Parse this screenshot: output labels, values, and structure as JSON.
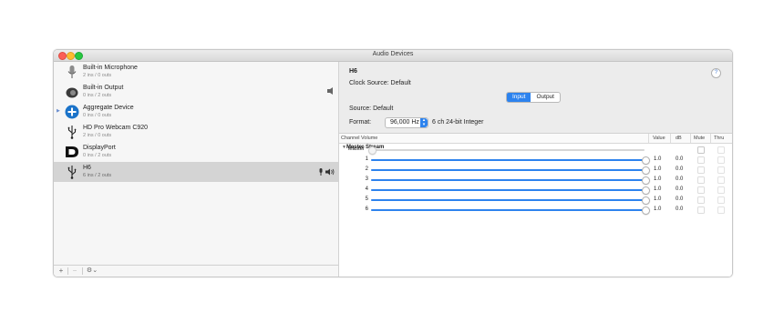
{
  "window": {
    "title": "Audio Devices"
  },
  "devices": [
    {
      "name": "Built-in Microphone",
      "sub": "2 ins / 0 outs",
      "icon": "microphone-icon",
      "selected": false
    },
    {
      "name": "Built-in Output",
      "sub": "0 ins / 2 outs",
      "icon": "speaker-icon",
      "selected": false
    },
    {
      "name": "Aggregate Device",
      "sub": "0 ins / 0 outs",
      "icon": "plus-circle-icon",
      "selected": false
    },
    {
      "name": "HD Pro Webcam C920",
      "sub": "2 ins / 0 outs",
      "icon": "usb-icon",
      "selected": false
    },
    {
      "name": "DisplayPort",
      "sub": "0 ins / 2 outs",
      "icon": "displayport-icon",
      "selected": false
    },
    {
      "name": "H6",
      "sub": "6 ins / 2 outs",
      "icon": "usb-icon",
      "selected": true
    }
  ],
  "sidebar_buttons": {
    "add": "+",
    "remove": "−",
    "gear": "⚙︎⌄"
  },
  "detail": {
    "device_title": "H6",
    "help": "?",
    "clock_source_label": "Clock Source:",
    "clock_source_value": "Default",
    "tabs": [
      "Input",
      "Output"
    ],
    "active_tab": "Input",
    "source_label": "Source:",
    "source_value": "Default",
    "format_label": "Format:",
    "format_rate": "96,000 Hz",
    "format_desc": "6 ch 24-bit Integer"
  },
  "table": {
    "headers": {
      "channel": "Channel Volume",
      "value": "Value",
      "db": "dB",
      "mute": "Mute",
      "thru": "Thru"
    },
    "stream_label": "Master Stream",
    "rows": [
      {
        "label": "Master",
        "level": 0.0,
        "value": "",
        "db": "",
        "enabled": false
      },
      {
        "label": "1",
        "level": 1.0,
        "value": "1.0",
        "db": "0.0",
        "enabled": true
      },
      {
        "label": "2",
        "level": 1.0,
        "value": "1.0",
        "db": "0.0",
        "enabled": true
      },
      {
        "label": "3",
        "level": 1.0,
        "value": "1.0",
        "db": "0.0",
        "enabled": true
      },
      {
        "label": "4",
        "level": 1.0,
        "value": "1.0",
        "db": "0.0",
        "enabled": true
      },
      {
        "label": "5",
        "level": 1.0,
        "value": "1.0",
        "db": "0.0",
        "enabled": true
      },
      {
        "label": "6",
        "level": 1.0,
        "value": "1.0",
        "db": "0.0",
        "enabled": true
      }
    ]
  },
  "colors": {
    "accent": "#2d83ee",
    "selection": "#d4d4d4"
  }
}
